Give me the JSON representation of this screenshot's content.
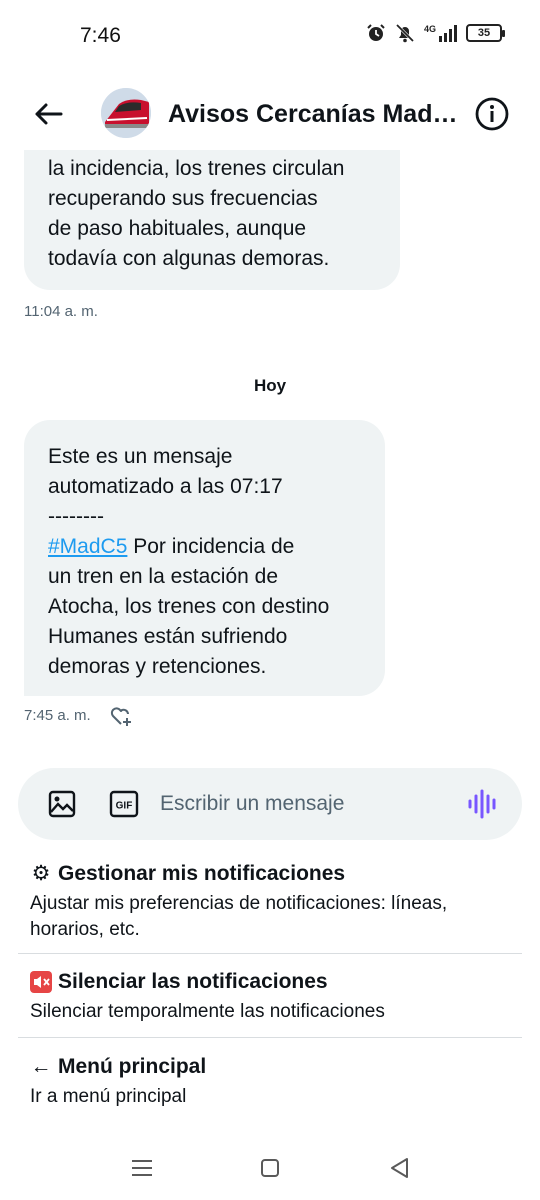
{
  "status": {
    "time": "7:46",
    "network": "4G",
    "battery": "35"
  },
  "header": {
    "title": "Avisos Cercanías Madrid",
    "back_icon": "arrow-left-icon",
    "info_icon": "info-icon"
  },
  "messages": [
    {
      "text": "la incidencia, los trenes circulan\nrecuperando sus frecuencias\nde paso habituales, aunque\ntodavía con algunas demoras.",
      "time": "11:04 a. m."
    },
    {
      "text_intro": "Este es un mensaje\nautomatizado a las 07:17\n--------",
      "hashtag": "#MadC5",
      "text_rest": " Por incidencia de\nun tren en la estación de\nAtocha, los trenes con destino\nHumanes están sufriendo\ndemoras y retenciones.",
      "time": "7:45 a. m."
    }
  ],
  "day_separator": "Hoy",
  "composer": {
    "placeholder": "Escribir un mensaje",
    "gif_label": "GIF"
  },
  "quick_replies": [
    {
      "icon": "⚙",
      "title": "Gestionar mis notificaciones",
      "description": "Ajustar mis preferencias de notificaciones: líneas, horarios, etc."
    },
    {
      "icon": "🔇",
      "title": "Silenciar las notificaciones",
      "description": "Silenciar temporalmente las notificaciones"
    },
    {
      "icon": "←",
      "title": "Menú principal",
      "description": "Ir a menú principal"
    }
  ],
  "colors": {
    "bubble_bg": "#eff3f4",
    "link": "#1d9bf0",
    "voice_accent": "#7856ff",
    "muted_text": "#536471"
  }
}
